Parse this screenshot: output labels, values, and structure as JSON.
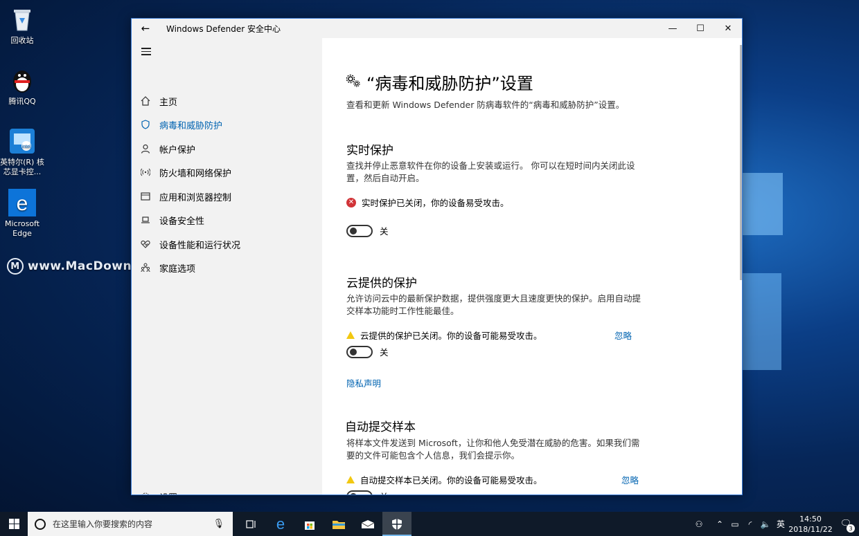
{
  "desktop": {
    "icons": [
      {
        "label": "回收站"
      },
      {
        "label": "腾讯QQ"
      },
      {
        "label": "英特尔(R) 核芯显卡控..."
      },
      {
        "label": "Microsoft Edge"
      }
    ],
    "watermark": "www.MacDown.com"
  },
  "window": {
    "title": "Windows Defender 安全中心",
    "back_glyph": "←",
    "min_glyph": "—",
    "max_glyph": "☐",
    "close_glyph": "✕"
  },
  "sidebar": {
    "items": [
      {
        "label": "主页",
        "icon": "home-icon"
      },
      {
        "label": "病毒和威胁防护",
        "icon": "shield-icon",
        "active": true
      },
      {
        "label": "帐户保护",
        "icon": "person-icon"
      },
      {
        "label": "防火墙和网络保护",
        "icon": "wifi-icon"
      },
      {
        "label": "应用和浏览器控制",
        "icon": "browser-icon"
      },
      {
        "label": "设备安全性",
        "icon": "laptop-icon"
      },
      {
        "label": "设备性能和运行状况",
        "icon": "heart-icon"
      },
      {
        "label": "家庭选项",
        "icon": "family-icon"
      }
    ],
    "settings_label": "设置"
  },
  "content": {
    "title": "“病毒和威胁防护”设置",
    "subtitle": "查看和更新 Windows Defender 防病毒软件的“病毒和威胁防护”设置。",
    "realtime": {
      "heading": "实时保护",
      "desc": "查找并停止恶意软件在你的设备上安装或运行。 你可以在短时间内关闭此设置，然后自动开启。",
      "status": "实时保护已关闭，你的设备易受攻击。",
      "toggle_label": "关"
    },
    "cloud": {
      "heading": "云提供的保护",
      "desc": "允许访问云中的最新保护数据，提供强度更大且速度更快的保护。启用自动提交样本功能时工作性能最佳。",
      "status": "云提供的保护已关闭。你的设备可能易受攻击。",
      "dismiss": "忽略",
      "toggle_label": "关",
      "privacy_link": "隐私声明"
    },
    "sample": {
      "heading": "自动提交样本",
      "desc": "将样本文件发送到 Microsoft，让你和他人免受潜在威胁的危害。如果我们需要的文件可能包含个人信息，我们会提示你。",
      "status": "自动提交样本已关闭。你的设备可能易受攻击。",
      "dismiss": "忽略",
      "toggle_label": "关"
    }
  },
  "taskbar": {
    "search_placeholder": "在这里输入你要搜索的内容",
    "ime": "英",
    "time": "14:50",
    "date": "2018/11/22",
    "notification_count": "3"
  }
}
